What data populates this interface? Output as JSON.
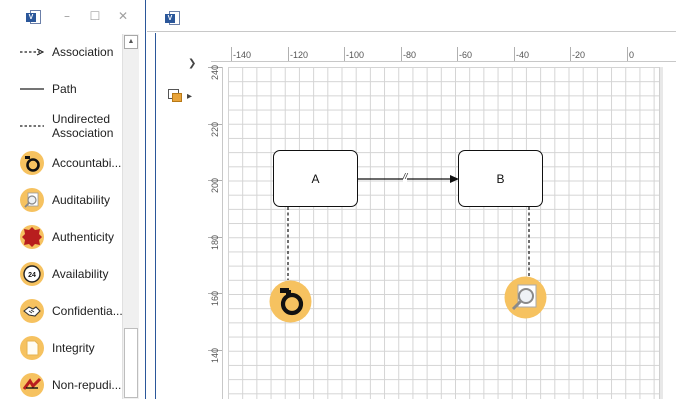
{
  "stencil": {
    "shapes": [
      {
        "label": "Association",
        "icon": "dashed-arrow-icon"
      },
      {
        "label": "Path",
        "icon": "solid-line-icon"
      },
      {
        "label": "Undirected\nAssociation",
        "icon": "dashed-line-icon"
      },
      {
        "label": "Accountabi...",
        "icon": "handcuffs-icon"
      },
      {
        "label": "Auditability",
        "icon": "magnifier-icon"
      },
      {
        "label": "Authenticity",
        "icon": "wax-seal-icon"
      },
      {
        "label": "Availability",
        "icon": "clock-24-icon"
      },
      {
        "label": "Confidentia...",
        "icon": "handshake-icon"
      },
      {
        "label": "Integrity",
        "icon": "page-icon"
      },
      {
        "label": "Non-repudi...",
        "icon": "signature-icon"
      }
    ]
  },
  "ruler": {
    "horizontal": [
      "-140",
      "-120",
      "-100",
      "-80",
      "-60",
      "-40",
      "-20",
      "0"
    ],
    "vertical": [
      "240",
      "220",
      "200",
      "180",
      "160",
      "140"
    ]
  },
  "diagram": {
    "node_a": "A",
    "node_b": "B",
    "edge_label": "//"
  },
  "colors": {
    "accent": "#2b579a",
    "badge": "#f6c260"
  }
}
